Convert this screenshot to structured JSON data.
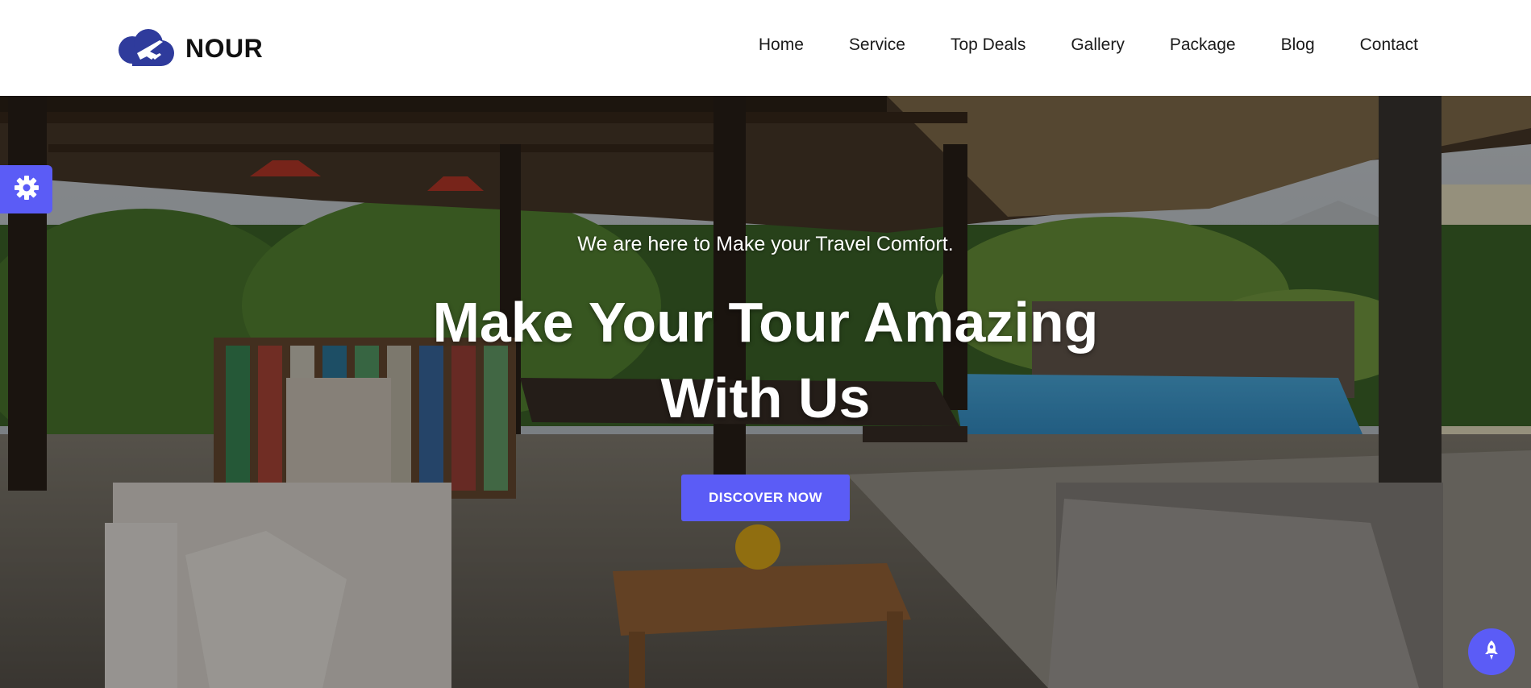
{
  "brand": {
    "name": "NOUR",
    "logo_icon": "cloud-plane-icon",
    "logo_color": "#2f3b9c"
  },
  "nav": {
    "items": [
      {
        "label": "Home"
      },
      {
        "label": "Service"
      },
      {
        "label": "Top Deals"
      },
      {
        "label": "Gallery"
      },
      {
        "label": "Package"
      },
      {
        "label": "Blog"
      },
      {
        "label": "Contact"
      }
    ]
  },
  "hero": {
    "subtitle": "We are here to Make your Travel Comfort.",
    "title_line1": "Make Your Tour Amazing",
    "title_line2": "With Us",
    "button_label": "DISCOVER NOW",
    "background_image": "gazebo-patio-pool-photo"
  },
  "widgets": {
    "settings_icon": "gear-icon",
    "back_to_top_icon": "rocket-icon"
  },
  "colors": {
    "accent": "#5b5cf6",
    "header_bg": "#ffffff",
    "nav_text": "#1b1b1b"
  }
}
